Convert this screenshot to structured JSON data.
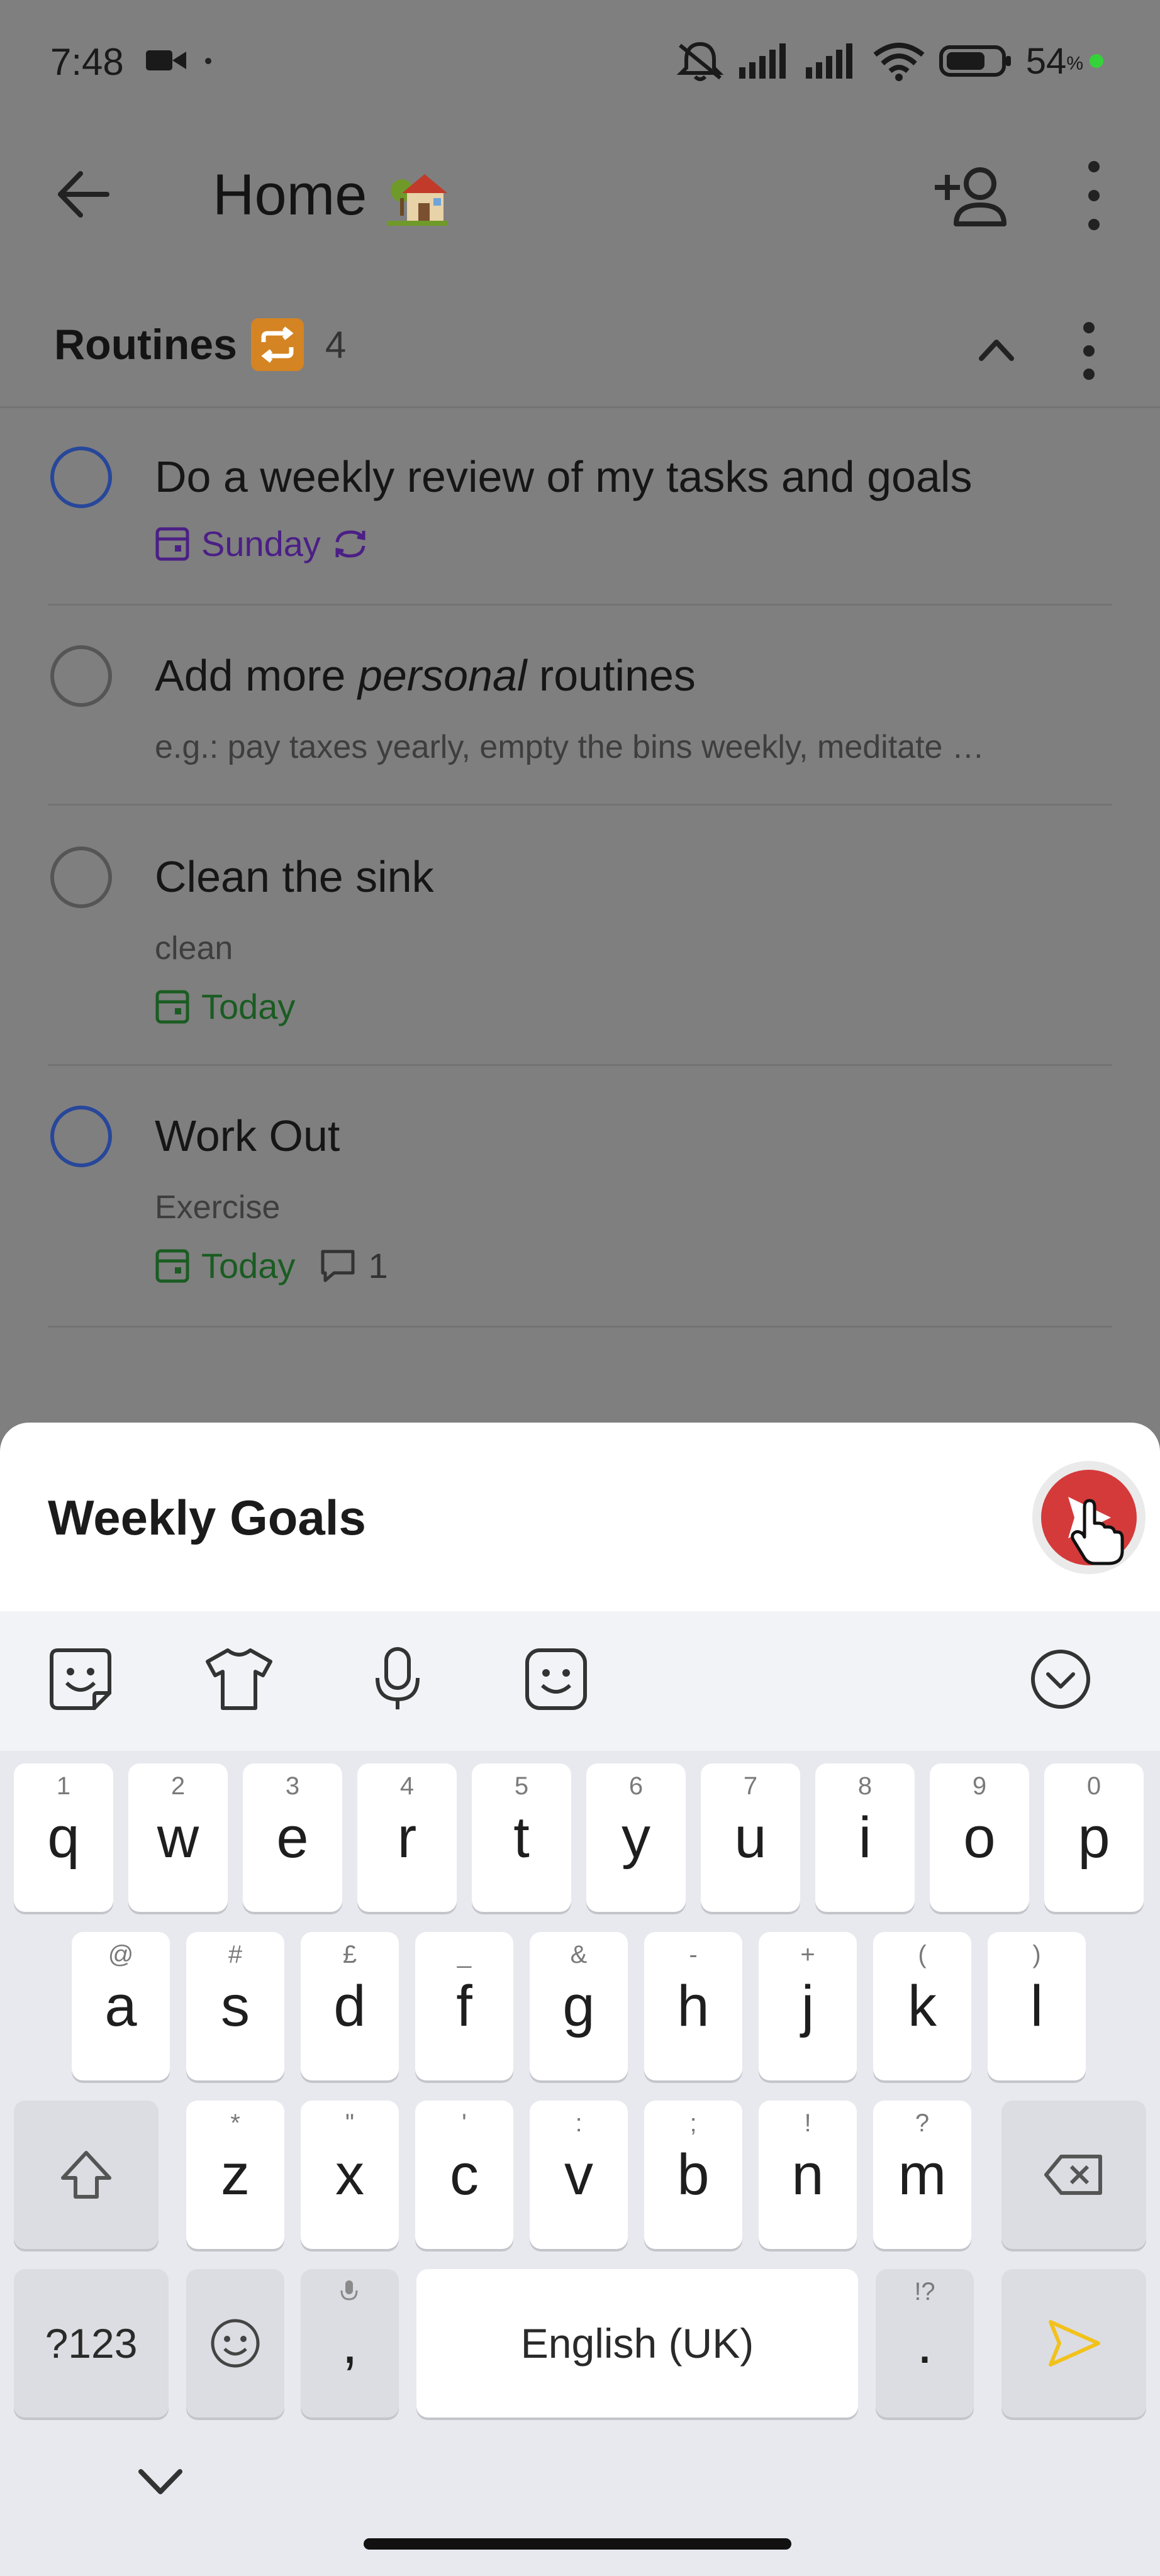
{
  "status_bar": {
    "time": "7:48",
    "battery": "54",
    "battery_unit": "%"
  },
  "header": {
    "title": "Home"
  },
  "section": {
    "title": "Routines",
    "count": "4"
  },
  "tasks": [
    {
      "title": "Do a weekly review of my tasks and goals",
      "due": "Sunday"
    },
    {
      "title_before": "Add more ",
      "title_em": "personal",
      "title_after": " routines",
      "subtitle": "e.g.: pay taxes yearly, empty the bins weekly, meditate …"
    },
    {
      "title": "Clean the sink",
      "subtitle": "clean",
      "due": "Today"
    },
    {
      "title": "Work Out",
      "subtitle": "Exercise",
      "due": "Today",
      "comments": "1"
    }
  ],
  "sheet": {
    "input_value": "Weekly Goals"
  },
  "keyboard": {
    "row1": [
      {
        "key": "q",
        "hint": "1"
      },
      {
        "key": "w",
        "hint": "2"
      },
      {
        "key": "e",
        "hint": "3"
      },
      {
        "key": "r",
        "hint": "4"
      },
      {
        "key": "t",
        "hint": "5"
      },
      {
        "key": "y",
        "hint": "6"
      },
      {
        "key": "u",
        "hint": "7"
      },
      {
        "key": "i",
        "hint": "8"
      },
      {
        "key": "o",
        "hint": "9"
      },
      {
        "key": "p",
        "hint": "0"
      }
    ],
    "row2": [
      {
        "key": "a",
        "hint": "@"
      },
      {
        "key": "s",
        "hint": "#"
      },
      {
        "key": "d",
        "hint": "£"
      },
      {
        "key": "f",
        "hint": "_"
      },
      {
        "key": "g",
        "hint": "&"
      },
      {
        "key": "h",
        "hint": "-"
      },
      {
        "key": "j",
        "hint": "+"
      },
      {
        "key": "k",
        "hint": "("
      },
      {
        "key": "l",
        "hint": ")"
      }
    ],
    "row3": [
      {
        "key": "z",
        "hint": "*"
      },
      {
        "key": "x",
        "hint": "\""
      },
      {
        "key": "c",
        "hint": "'"
      },
      {
        "key": "v",
        "hint": ":"
      },
      {
        "key": "b",
        "hint": ";"
      },
      {
        "key": "n",
        "hint": "!"
      },
      {
        "key": "m",
        "hint": "?"
      }
    ],
    "symbols_label": "?123",
    "comma": ",",
    "space_label": "English (UK)",
    "period": ".",
    "period_hint": "!?"
  },
  "colors": {
    "accent_red": "#d43a3a",
    "due_purple": "#4b1f86",
    "due_green": "#1a5c22",
    "checkbox_blue": "#27479a",
    "send_yellow": "#f2c21b"
  }
}
